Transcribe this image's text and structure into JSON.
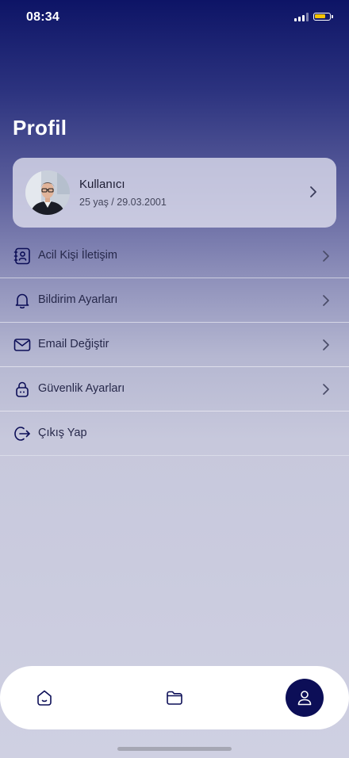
{
  "status_bar": {
    "time": "08:34",
    "battery_color": "#f5c400"
  },
  "page": {
    "title": "Profil"
  },
  "profile": {
    "name": "Kullanıcı",
    "details": "25 yaş / 29.03.2001"
  },
  "menu": [
    {
      "label": "Acil Kişi İletişim",
      "icon": "contact-book-icon"
    },
    {
      "label": "Bildirim Ayarları",
      "icon": "bell-icon"
    },
    {
      "label": "Email Değiştir",
      "icon": "mail-icon"
    },
    {
      "label": "Güvenlik Ayarları",
      "icon": "lock-icon"
    },
    {
      "label": "Çıkış Yap",
      "icon": "logout-icon"
    }
  ],
  "bottom_nav": [
    {
      "icon": "home-icon",
      "active": false
    },
    {
      "icon": "folder-icon",
      "active": false
    },
    {
      "icon": "user-icon",
      "active": true
    }
  ],
  "colors": {
    "accent": "#0c0e57",
    "header_top": "#0d1466",
    "background": "#cfd0e2"
  }
}
